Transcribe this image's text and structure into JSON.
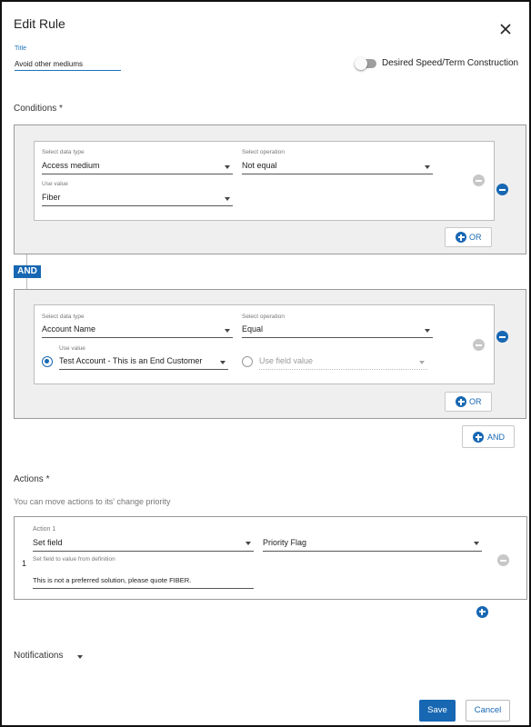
{
  "dialog": {
    "title": "Edit Rule",
    "close_icon": "close-icon"
  },
  "title_field": {
    "label": "Title",
    "value": "Avoid other mediums"
  },
  "toggle": {
    "label": "Desired Speed/Term Construction",
    "on": false
  },
  "conditions": {
    "label": "Conditions *",
    "groups": [
      {
        "data_type_label": "Select data type",
        "data_type_value": "Access medium",
        "operation_label": "Select operation",
        "operation_value": "Not equal",
        "use_value_label": "Use value",
        "use_value_value": "Fiber",
        "or_button": "OR"
      },
      {
        "data_type_label": "Select data type",
        "data_type_value": "Account Name",
        "operation_label": "Select operation",
        "operation_value": "Equal",
        "use_value_label": "Use value",
        "use_value_value": "Test Account - This is an End Customer",
        "use_field_value_label": "Use field value",
        "or_button": "OR"
      }
    ],
    "and_badge": "AND",
    "and_button": "AND"
  },
  "actions": {
    "label": "Actions *",
    "hint": "You can move actions to its' change priority",
    "items": [
      {
        "label": "Action 1",
        "number": "1",
        "type_value": "Set field",
        "field_value": "Priority Flag",
        "value_label": "Set field to value from definition",
        "value_text": "This is not a preferred solution, please quote FIBER."
      }
    ]
  },
  "notifications": {
    "label": "Notifications"
  },
  "footer": {
    "save": "Save",
    "cancel": "Cancel"
  },
  "colors": {
    "accent": "#1767b3",
    "group_bg": "#efefef"
  }
}
